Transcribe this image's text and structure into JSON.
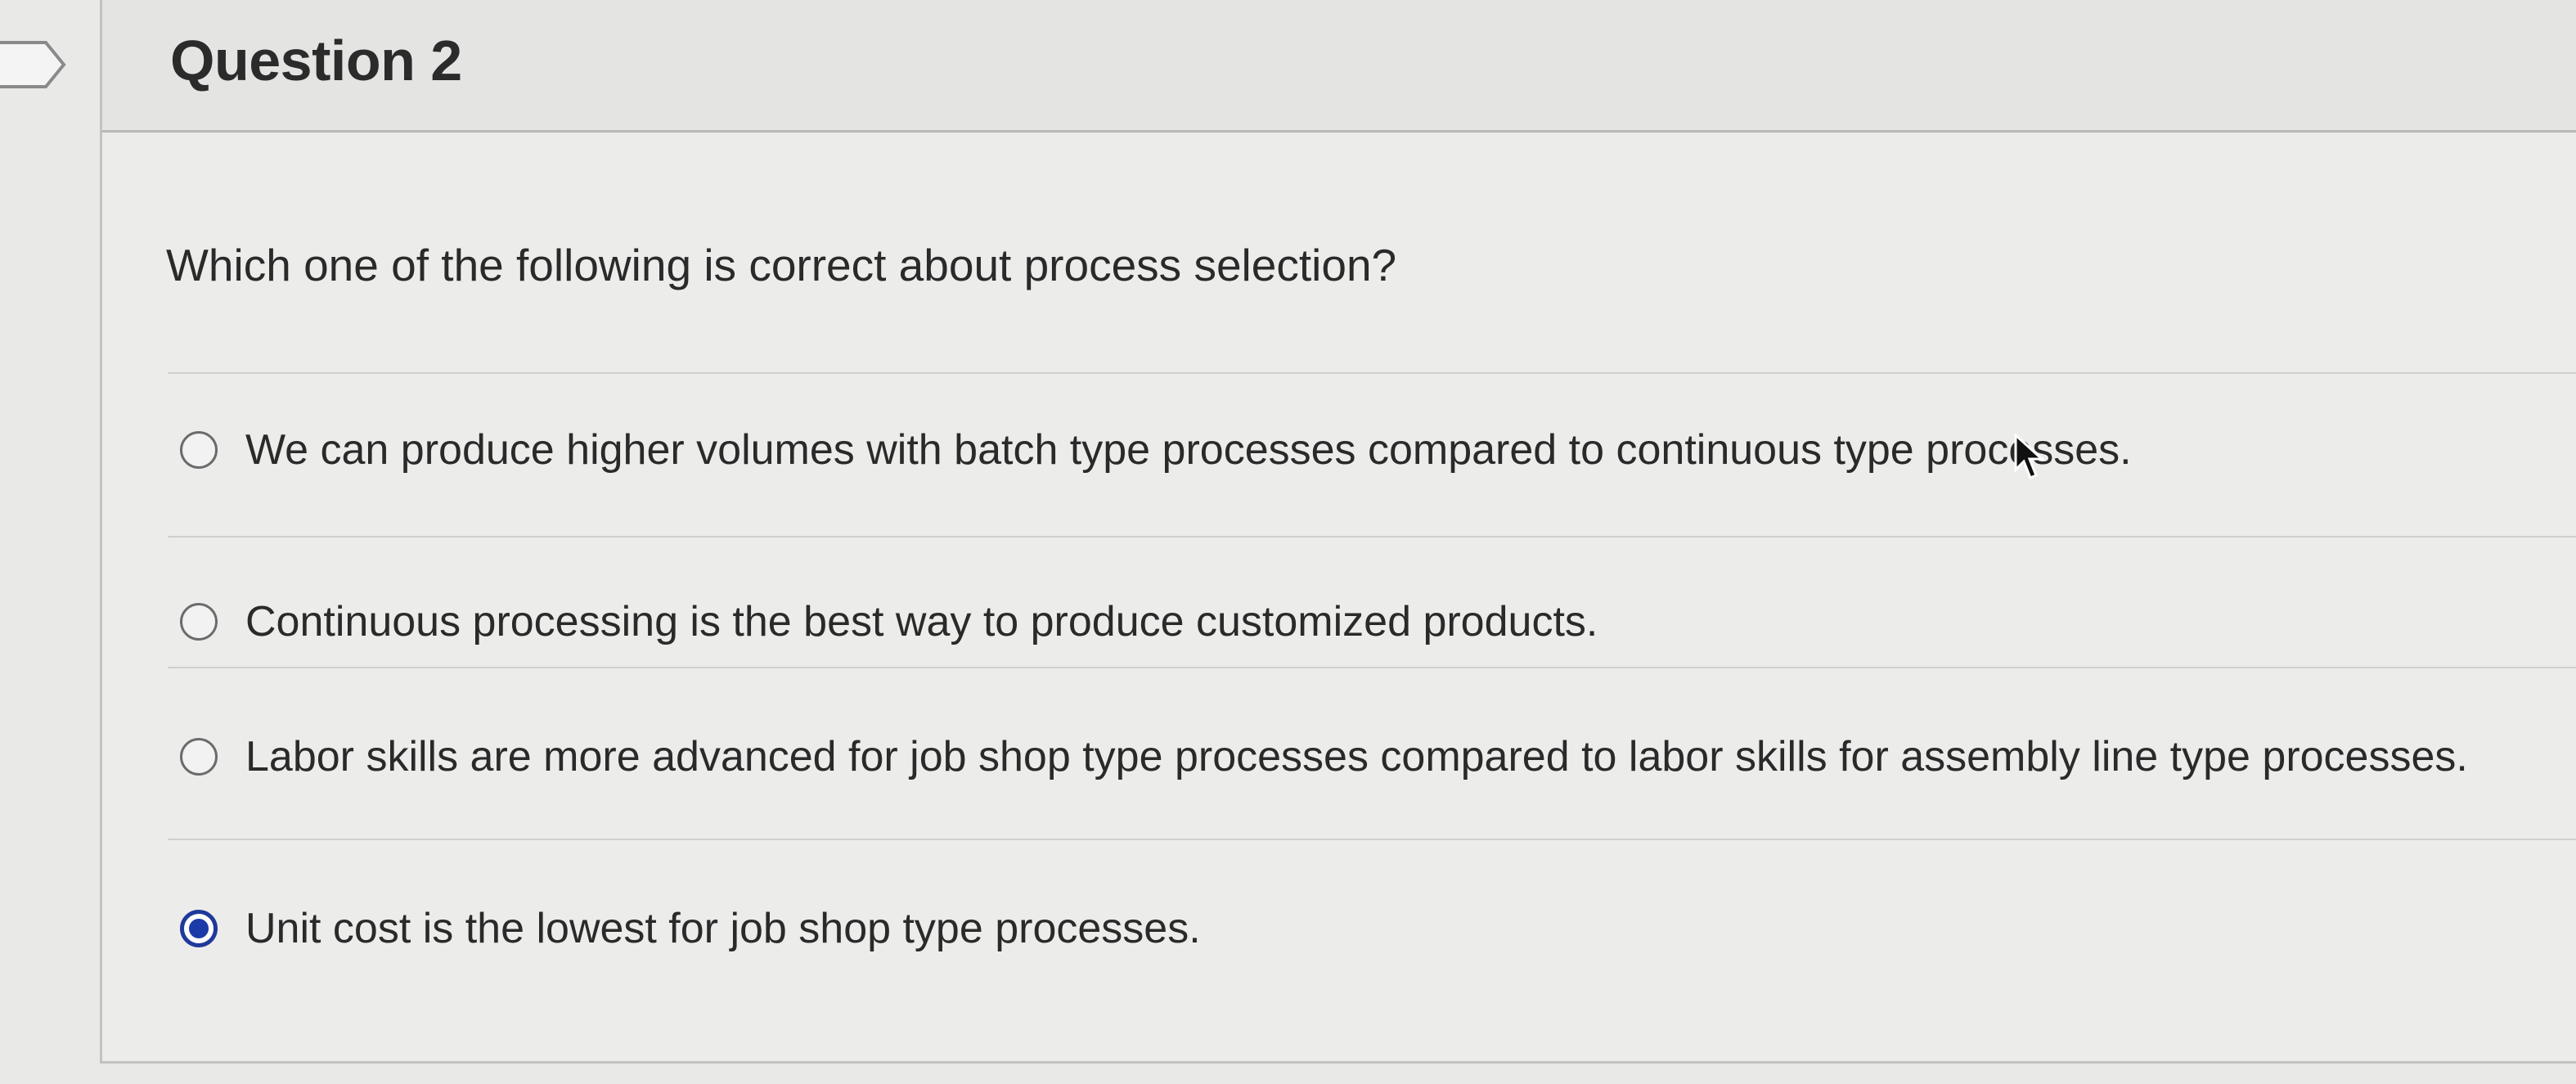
{
  "question": {
    "title": "Question 2",
    "prompt": "Which one of the following is correct about process selection?"
  },
  "answers": [
    {
      "label": "We can produce higher volumes with batch type processes compared to continuous type processes.",
      "selected": false
    },
    {
      "label": "Continuous processing is the best way to produce customized products.",
      "selected": false
    },
    {
      "label": "Labor skills are more advanced for job shop type processes compared to labor skills for assembly line type processes.",
      "selected": false
    },
    {
      "label": "Unit cost is the lowest for job shop type processes.",
      "selected": true
    }
  ],
  "colors": {
    "selected_radio": "#1c3ba8",
    "text": "#2a2a2a",
    "background": "#e9e9e8"
  },
  "icons": {
    "bookmark": "bookmark-flag-icon",
    "cursor": "mouse-pointer-icon"
  }
}
